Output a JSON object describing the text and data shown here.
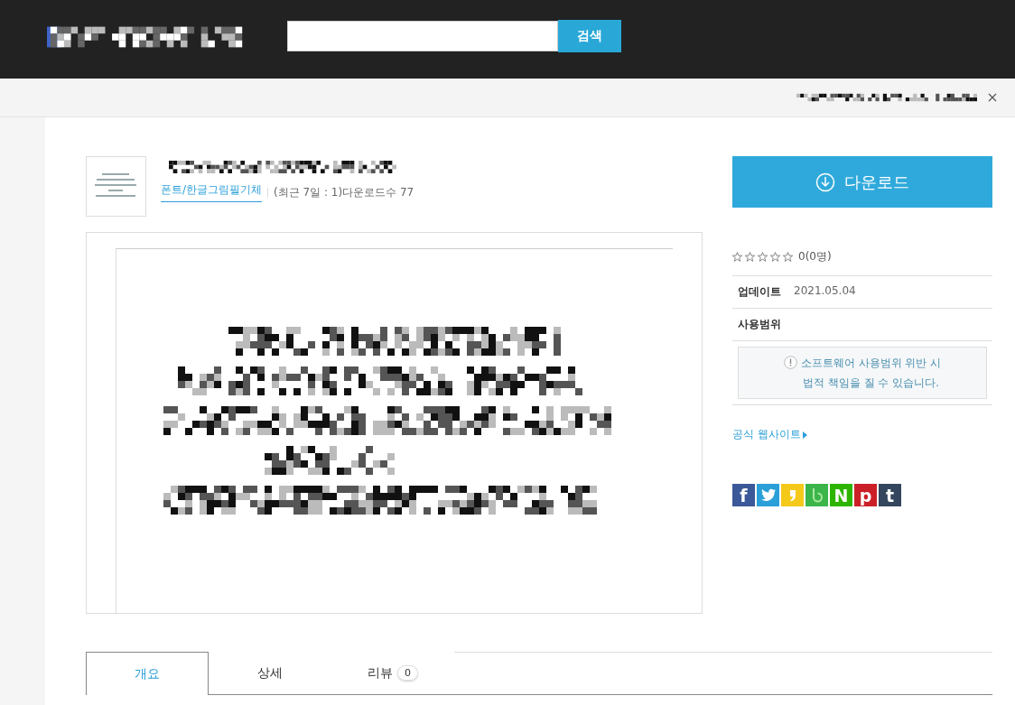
{
  "header": {
    "search": {
      "button": "검색"
    }
  },
  "item": {
    "category": "폰트/한글그림필기체",
    "stats": "(최근 7일 : 1)다운로드수  77"
  },
  "download": {
    "label": "다운로드"
  },
  "rating": {
    "stars": 0,
    "text": "0(0명)"
  },
  "info": [
    {
      "label": "업데이트",
      "value": "2021.05.04"
    },
    {
      "label": "사용범위"
    }
  ],
  "warning": {
    "lines": [
      "소프트웨어 사용범위 위반 시",
      "법적 책임을 질 수 있습니다."
    ]
  },
  "website": {
    "label": "공식 웹사이트"
  },
  "share": [
    {
      "kind": "letter",
      "glyph": "f",
      "color": "#3b5998"
    },
    {
      "kind": "bird",
      "color": "#2a9fd8"
    },
    {
      "kind": "comma",
      "color": "#f5c91a"
    },
    {
      "kind": "band",
      "color": "#3bb54a"
    },
    {
      "kind": "letter",
      "glyph": "N",
      "color": "#2db400"
    },
    {
      "kind": "letter",
      "glyph": "p",
      "color": "#cb2027"
    },
    {
      "kind": "letter",
      "glyph": "t",
      "color": "#34465d"
    }
  ],
  "tabs": [
    {
      "label": "개요",
      "selected": true
    },
    {
      "label": "상세",
      "selected": false
    },
    {
      "label": "리뷰",
      "count": "0",
      "selected": false
    }
  ]
}
